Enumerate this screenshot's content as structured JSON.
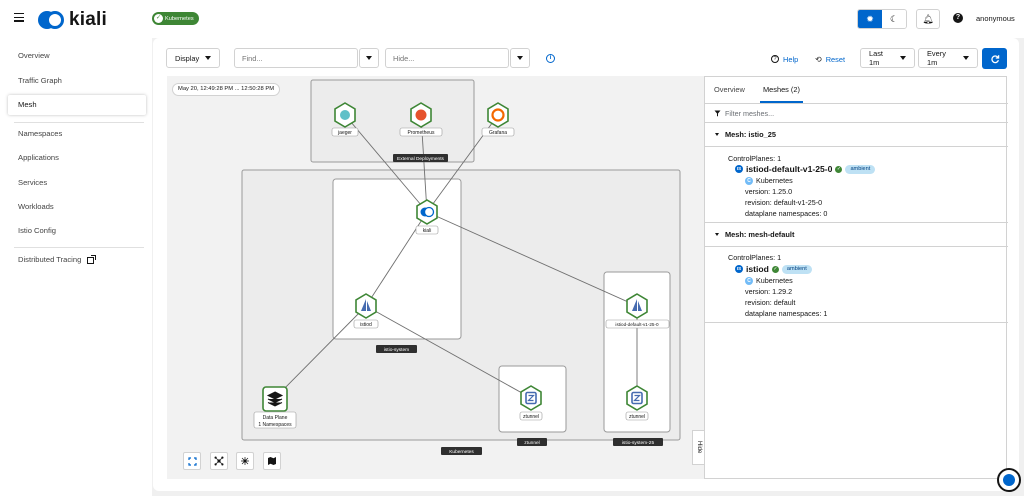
{
  "header": {
    "brand": "kiali",
    "cluster_badge": "Kubernetes",
    "user": "anonymous",
    "colors": {
      "primary": "#0066cc",
      "success": "#3e8635"
    }
  },
  "sidebar": {
    "items": [
      {
        "label": "Overview",
        "active": false
      },
      {
        "label": "Traffic Graph",
        "active": false
      },
      {
        "label": "Mesh",
        "active": true
      },
      {
        "label": "Namespaces",
        "active": false
      },
      {
        "label": "Applications",
        "active": false
      },
      {
        "label": "Services",
        "active": false
      },
      {
        "label": "Workloads",
        "active": false
      },
      {
        "label": "Istio Config",
        "active": false
      },
      {
        "label": "Distributed Tracing",
        "active": false
      }
    ]
  },
  "toolbar": {
    "display_label": "Display",
    "find_placeholder": "Find...",
    "hide_placeholder": "Hide...",
    "help_label": "Help",
    "reset_label": "Reset",
    "duration_label": "Last 1m",
    "refresh_interval_label": "Every 1m"
  },
  "graph": {
    "timestamp": "May 20, 12:49:28 PM ... 12:50:28 PM",
    "boxes": {
      "external": "External Deployments",
      "istio_system": "istio-system",
      "ztunnel": "ztunnel",
      "istio_system_25": "istio-system-25",
      "kubernetes": "Kubernetes"
    },
    "nodes": {
      "jaeger": "jaeger",
      "prometheus": "Prometheus",
      "grafana": "Grafana",
      "kiali": "kiali",
      "istiod": "istiod",
      "istiod_125": "istiod-default-v1-25-0",
      "data_plane": "Data Plane",
      "data_plane_sub": "1 Namespaces",
      "ztunnel_a": "ztunnel",
      "ztunnel_b": "ztunnel"
    },
    "hide_tab": "Hide"
  },
  "panel": {
    "tabs": [
      {
        "label": "Overview",
        "active": false
      },
      {
        "label": "Meshes (2)",
        "active": true
      }
    ],
    "filter_placeholder": "Filter meshes...",
    "meshes": [
      {
        "title": "Mesh: istio_25",
        "controlplanes": "ControlPlanes: 1",
        "cp_name": "istiod-default-v1-25-0",
        "cp_label": "ambient",
        "cluster": "Kubernetes",
        "version": "version: 1.25.0",
        "revision": "revision: default-v1-25-0",
        "namespaces": "dataplane namespaces: 0"
      },
      {
        "title": "Mesh: mesh-default",
        "controlplanes": "ControlPlanes: 1",
        "cp_name": "istiod",
        "cp_label": "ambient",
        "cluster": "Kubernetes",
        "version": "version: 1.29.2",
        "revision": "revision: default",
        "namespaces": "dataplane namespaces: 1"
      }
    ]
  }
}
